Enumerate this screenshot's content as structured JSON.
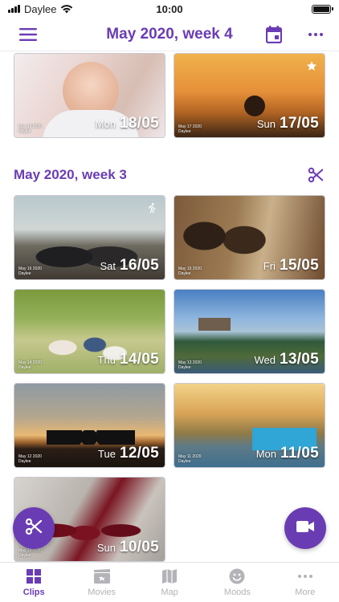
{
  "status_bar": {
    "carrier": "Daylee",
    "time": "10:00"
  },
  "header": {
    "title": "May 2020, week 4",
    "menu_icon": "hamburger-icon",
    "calendar_icon": "calendar-icon",
    "more_icon": "more-dots-icon"
  },
  "week4_tiles": [
    {
      "weekday": "Mon",
      "date": "18/05",
      "stamp_date": "May 18 2020",
      "stamp_app": "Daylee",
      "badge": "",
      "mood": ""
    },
    {
      "weekday": "Sun",
      "date": "17/05",
      "stamp_date": "May 17 2020",
      "stamp_app": "Daylee",
      "badge": "star-icon"
    }
  ],
  "week3": {
    "heading": "May 2020, week 3",
    "action_icon": "scissors-icon",
    "tiles": [
      {
        "weekday": "Sat",
        "date": "16/05",
        "stamp_date": "May 16 2020",
        "stamp_app": "Daylee",
        "badge": "running-figure-icon"
      },
      {
        "weekday": "Fri",
        "date": "15/05",
        "stamp_date": "May 15 2020",
        "stamp_app": "Daylee"
      },
      {
        "weekday": "Thu",
        "date": "14/05",
        "stamp_date": "May 14 2020",
        "stamp_app": "Daylee"
      },
      {
        "weekday": "Wed",
        "date": "13/05",
        "stamp_date": "May 13 2020",
        "stamp_app": "Daylee"
      },
      {
        "weekday": "Tue",
        "date": "12/05",
        "stamp_date": "May 12 2020",
        "stamp_app": "Daylee"
      },
      {
        "weekday": "Mon",
        "date": "11/05",
        "stamp_date": "May 11 2020",
        "stamp_app": "Daylee"
      },
      {
        "weekday": "Sun",
        "date": "10/05",
        "stamp_date": "May 10 2020",
        "stamp_app": "Daylee"
      }
    ]
  },
  "fabs": {
    "left_icon": "scissors-icon",
    "right_icon": "video-camera-icon"
  },
  "tabs": [
    {
      "label": "Clips",
      "icon": "grid-icon",
      "active": true
    },
    {
      "label": "Movies",
      "icon": "clapperboard-icon",
      "active": false
    },
    {
      "label": "Map",
      "icon": "map-icon",
      "active": false
    },
    {
      "label": "Moods",
      "icon": "smiley-icon",
      "active": false
    },
    {
      "label": "More",
      "icon": "more-dots-icon",
      "active": false
    }
  ],
  "colors": {
    "accent": "#6a3cb4",
    "inactive": "#b3b3b8",
    "text": "#1f1f1f"
  }
}
